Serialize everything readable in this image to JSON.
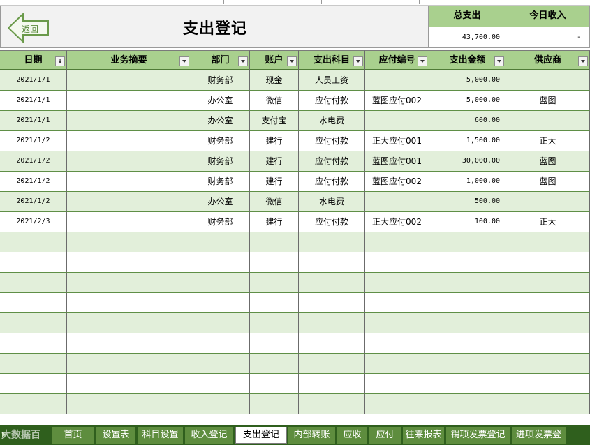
{
  "header": {
    "back_label": "返回",
    "title": "支出登记",
    "total_expense_label": "总支出",
    "total_expense_value": "43,700.00",
    "today_income_label": "今日收入",
    "today_income_value": "-"
  },
  "table": {
    "columns": [
      "日期",
      "业务摘要",
      "部门",
      "账户",
      "支出科目",
      "应付编号",
      "支出金额",
      "供应商"
    ],
    "rows": [
      [
        "2021/1/1",
        "",
        "财务部",
        "现金",
        "人员工资",
        "",
        "5,000.00",
        ""
      ],
      [
        "2021/1/1",
        "",
        "办公室",
        "微信",
        "应付付款",
        "蓝图应付002",
        "5,000.00",
        "蓝图"
      ],
      [
        "2021/1/1",
        "",
        "办公室",
        "支付宝",
        "水电费",
        "",
        "600.00",
        ""
      ],
      [
        "2021/1/2",
        "",
        "财务部",
        "建行",
        "应付付款",
        "正大应付001",
        "1,500.00",
        "正大"
      ],
      [
        "2021/1/2",
        "",
        "财务部",
        "建行",
        "应付付款",
        "蓝图应付001",
        "30,000.00",
        "蓝图"
      ],
      [
        "2021/1/2",
        "",
        "财务部",
        "建行",
        "应付付款",
        "蓝图应付002",
        "1,000.00",
        "蓝图"
      ],
      [
        "2021/1/2",
        "",
        "办公室",
        "微信",
        "水电费",
        "",
        "500.00",
        ""
      ],
      [
        "2021/2/3",
        "",
        "财务部",
        "建行",
        "应付付款",
        "正大应付002",
        "100.00",
        "正大"
      ]
    ],
    "empty_rows": 9
  },
  "tabs": [
    {
      "label": "首页"
    },
    {
      "label": "设置表"
    },
    {
      "label": "科目设置"
    },
    {
      "label": "收入登记"
    },
    {
      "label": "支出登记",
      "active": true
    },
    {
      "label": "内部转账"
    },
    {
      "label": "应收"
    },
    {
      "label": "应付"
    },
    {
      "label": "往来报表"
    },
    {
      "label": "销项发票登记"
    },
    {
      "label": "进项发票登"
    }
  ],
  "watermark": "大数据百",
  "colors": {
    "header_green": "#a9d08e",
    "row_green": "#e2efda",
    "tab_green": "#5e8d3e",
    "tabbar_dark": "#2f5f1d"
  }
}
